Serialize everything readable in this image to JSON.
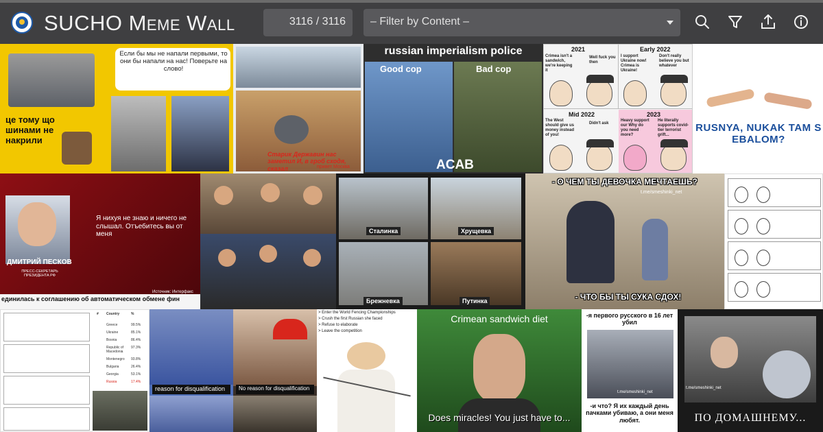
{
  "app": {
    "title": "SUCHO Meme Wall",
    "logo_icon": "sucho-logo"
  },
  "toolbar": {
    "counter": "3116 / 3116",
    "filter_label": "– Filter by Content –",
    "icons": [
      "search-icon",
      "filter-icon",
      "share-icon",
      "info-icon"
    ]
  },
  "colors": {
    "header_bg": "#3f3f41",
    "control_bg": "#59595c",
    "text": "#f2f2f2"
  },
  "memes": {
    "m1": {
      "caption": "це тому що шинами не накрили"
    },
    "m2": {
      "caption": "Если бы мы не напали первыми, то они бы напали на нас! Поверьте на слово!"
    },
    "m3": {
      "caption": "Старик Державин нас заметил И, в гроб сходя, сказал",
      "note": "привет Москва"
    },
    "m4": {
      "title": "russian imperialism police",
      "left_label": "Good cop",
      "right_label": "Bad cop",
      "bottom": "ACAB"
    },
    "m5": {
      "panels": [
        {
          "year": "2021",
          "left": "Crimea isn't a sandwich, we're keeping it",
          "right": "Well fuck you then"
        },
        {
          "year": "Early 2022",
          "left": "I support Ukraine now! Crimea is Ukraine!",
          "right": "Don't really believe you but whatever"
        },
        {
          "year": "Mid 2022",
          "left": "The West should give us money instead of you!",
          "right": "Didn't ask"
        },
        {
          "year": "2023",
          "left": "Heavy support our Why do you need more?",
          "right": "He literally supports covid-tier terrorist grift..."
        }
      ]
    },
    "m6": {
      "caption": "RUSNYA, NUKAK TAM S EBALOM?"
    },
    "m7": {
      "quote": "Я нихуя не знаю и ничего не слышал. Отъебитесь вы от меня",
      "name": "ДМИТРИЙ ПЕСКОВ",
      "role": "ПРЕСС-СЕКРЕТАРЬ ПРЕЗИДЕНТА РФ",
      "ticker": "единилась к соглашению об автоматическом обмене фин",
      "source": "Источник: Интерфакс"
    },
    "m8": {
      "labels": [
        "Сталинка",
        "Хрущевка",
        "Брежневка",
        "Путинка"
      ]
    },
    "m9": {
      "top": "- О ЧЕМ ТЫ ДЕВОЧКА МЕЧТАЕШЬ?",
      "bottom": "- ЧТО БЫ ТЫ СУКА СДОХ!",
      "watermark": "t.me/smeshinki_net"
    },
    "m11": {
      "headers": [
        "#",
        "Country",
        "%"
      ],
      "rows": [
        "Greece",
        "Ukraine",
        "Bosnia",
        "Republic of Macedonia",
        "Montenegro",
        "Bulgaria",
        "Georgia",
        "Russia"
      ],
      "values": [
        "99.5%",
        "85.1%",
        "86.4%",
        "97.3%",
        "93.8%",
        "26.4%",
        "53.1%",
        "17.4%"
      ]
    },
    "m12": {
      "top_caption": "reason for disqualification",
      "mid_caption": "No reason for disqualification"
    },
    "m13": {
      "lines": [
        "> Enter the World Fencing Championships",
        "> Crush the first Russian she faced",
        "> Refuse to elaborate",
        "> Leave the competition"
      ]
    },
    "m14": {
      "top": "Crimean sandwich diet",
      "bottom": "Does miracles! You just have to..."
    },
    "m15": {
      "top": "-я первого русского в 16 лет убил",
      "bottom": "-и что? Я их каждый день пачками убиваю, а они меня любят.",
      "watermark": "t.me/smeshinki_net"
    },
    "m16": {
      "bottom": "ПО ДОМАШНЕМУ...",
      "watermark": "t.me/smeshinki_net"
    }
  }
}
